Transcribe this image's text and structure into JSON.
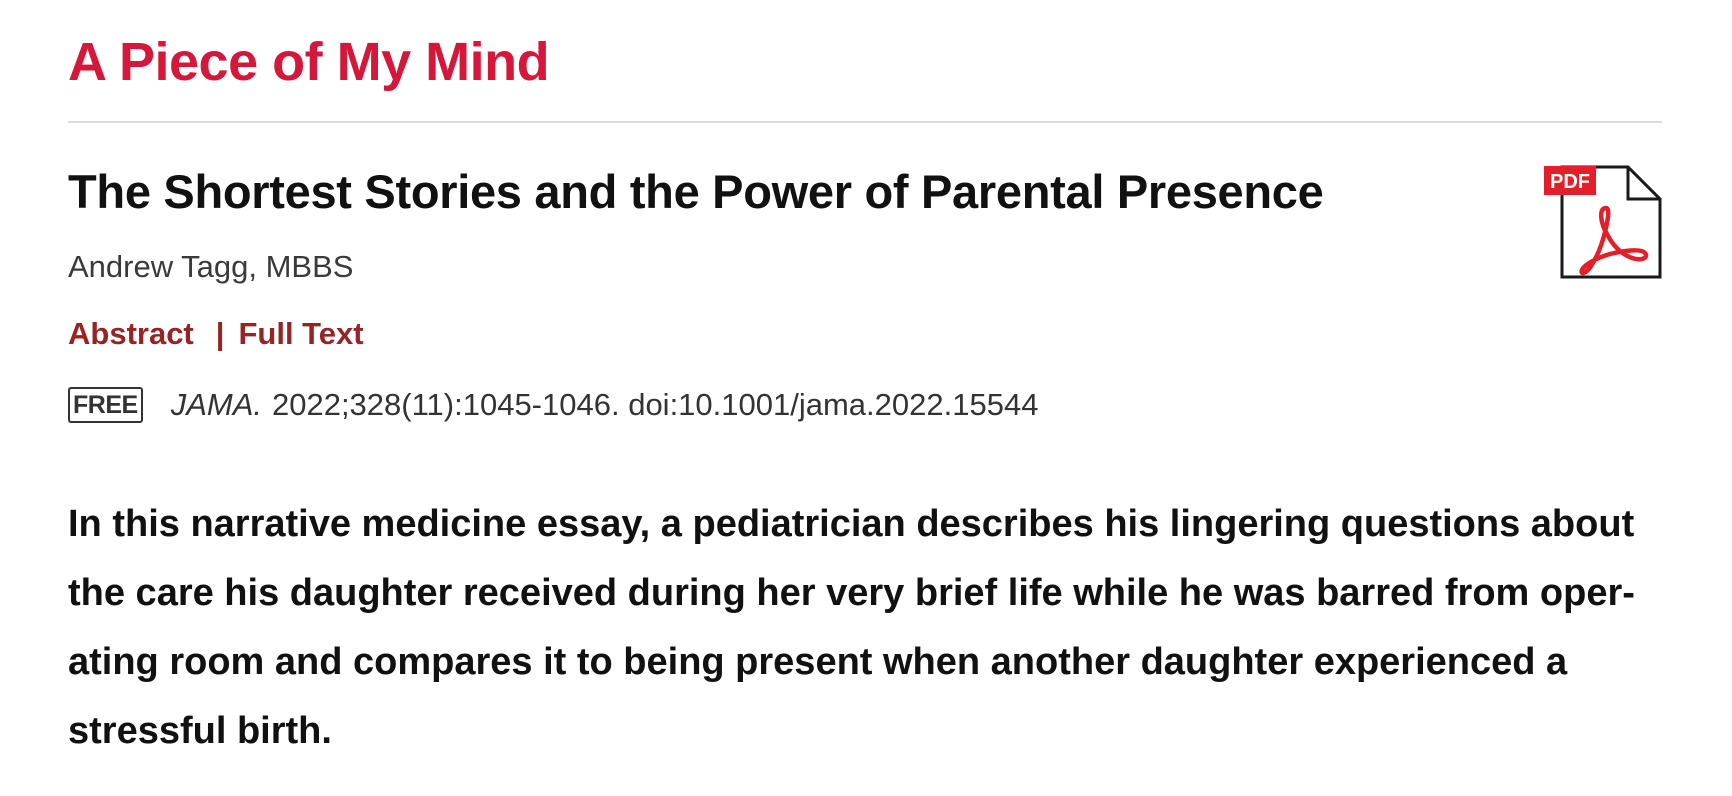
{
  "section_title": "A Piece of My Mind",
  "article": {
    "title": "The Shortest Stories and the Power of Parental Presence",
    "authors": "Andrew Tagg, MBBS",
    "links": {
      "abstract": "Abstract",
      "separator": "|",
      "full_text": "Full Text"
    },
    "access_badge": "FREE",
    "citation": {
      "journal": "JAMA.",
      "details": "2022;328(11):1045-1046. doi:10.1001/jama.2022.15544"
    },
    "pdf_icon": {
      "icon": "pdf-file-icon",
      "label": "PDF"
    },
    "abstract_lines": [
      "In this narrative medicine essay, a pediatrician describes his lingering questions about",
      "the care his daughter received during her very brief life while he was barred from oper-",
      "ating room and compares it to being present when another daughter experienced a",
      "stressful birth."
    ]
  },
  "colors": {
    "section_title": "#d4173a",
    "links": "#962424",
    "pdf_red": "#e3202a"
  }
}
